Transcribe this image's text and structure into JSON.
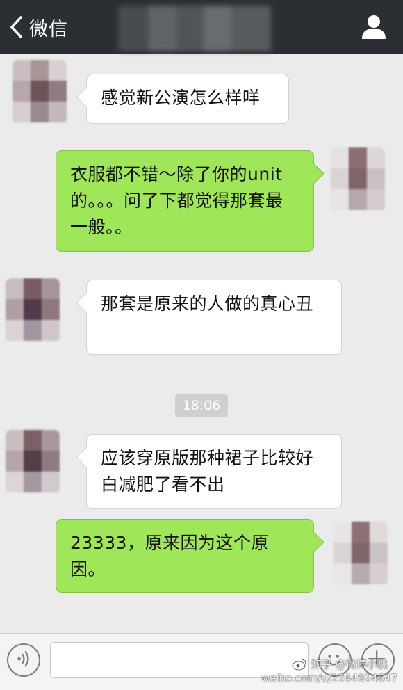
{
  "header": {
    "back_label": "微信"
  },
  "messages": [
    {
      "side": "left",
      "text": "感觉新公演怎么样咩"
    },
    {
      "side": "right",
      "text": "衣服都不错～除了你的unit的。。。问了下都觉得那套最一般。。"
    },
    {
      "side": "left",
      "text": "那套是原来的人做的真心丑"
    },
    {
      "side": "left",
      "text": "应该穿原版那种裙子比较好 白减肥了看不出"
    },
    {
      "side": "right",
      "text": "23333，原来因为这个原因。"
    }
  ],
  "timestamp": "18:06",
  "input": {
    "value": "",
    "placeholder": ""
  },
  "watermark": {
    "line1": "知乎 @微博小桃",
    "line2": "weibo.com/u/2244924647"
  },
  "colors": {
    "header_bg": "#2b2e33",
    "chat_bg": "#ebebeb",
    "bubble_sent": "#9fe658",
    "bubble_received": "#ffffff"
  },
  "icons": {
    "back": "chevron-left-icon",
    "profile": "person-icon",
    "voice": "voice-icon",
    "emoji": "smiley-icon",
    "plus": "plus-icon"
  }
}
